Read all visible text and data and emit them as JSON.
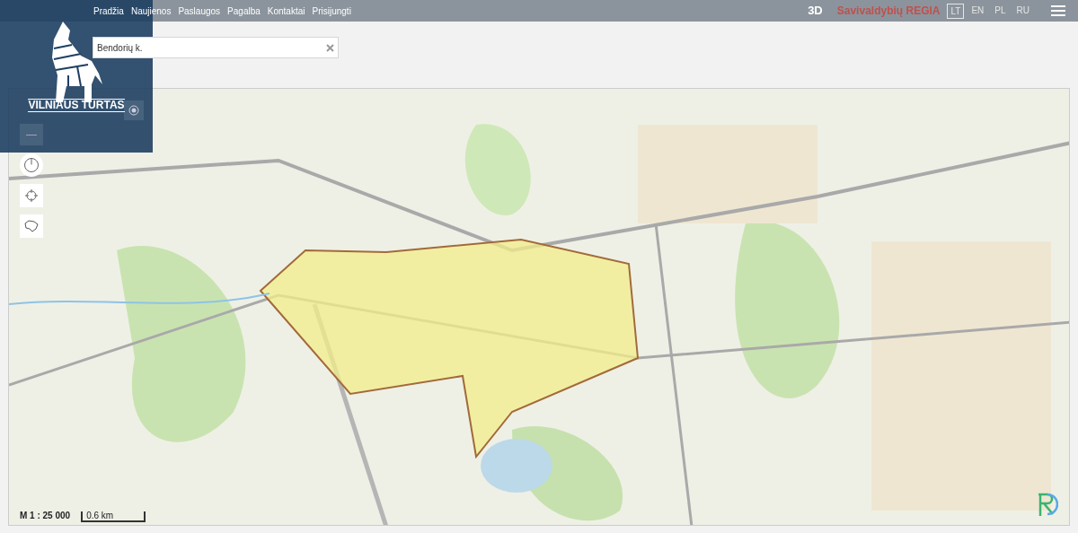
{
  "nav": {
    "links": [
      "Pradžia",
      "Naujienos",
      "Paslaugos",
      "Pagalba",
      "Kontaktai",
      "Prisijungti"
    ],
    "mode_3d": "3D",
    "brand": "Savivaldybių REGIA",
    "languages": [
      {
        "label": "LT",
        "selected": true
      },
      {
        "label": "EN",
        "selected": false
      },
      {
        "label": "PL",
        "selected": false
      },
      {
        "label": "RU",
        "selected": false
      }
    ]
  },
  "search": {
    "value": "Bendorių k."
  },
  "logo_overlay": {
    "title": "VILNIAUS TURTAS"
  },
  "map": {
    "kind": "picture",
    "zoom_out": "—",
    "scale": "M 1 : 25 000",
    "scale_bar": "0.6 km"
  }
}
